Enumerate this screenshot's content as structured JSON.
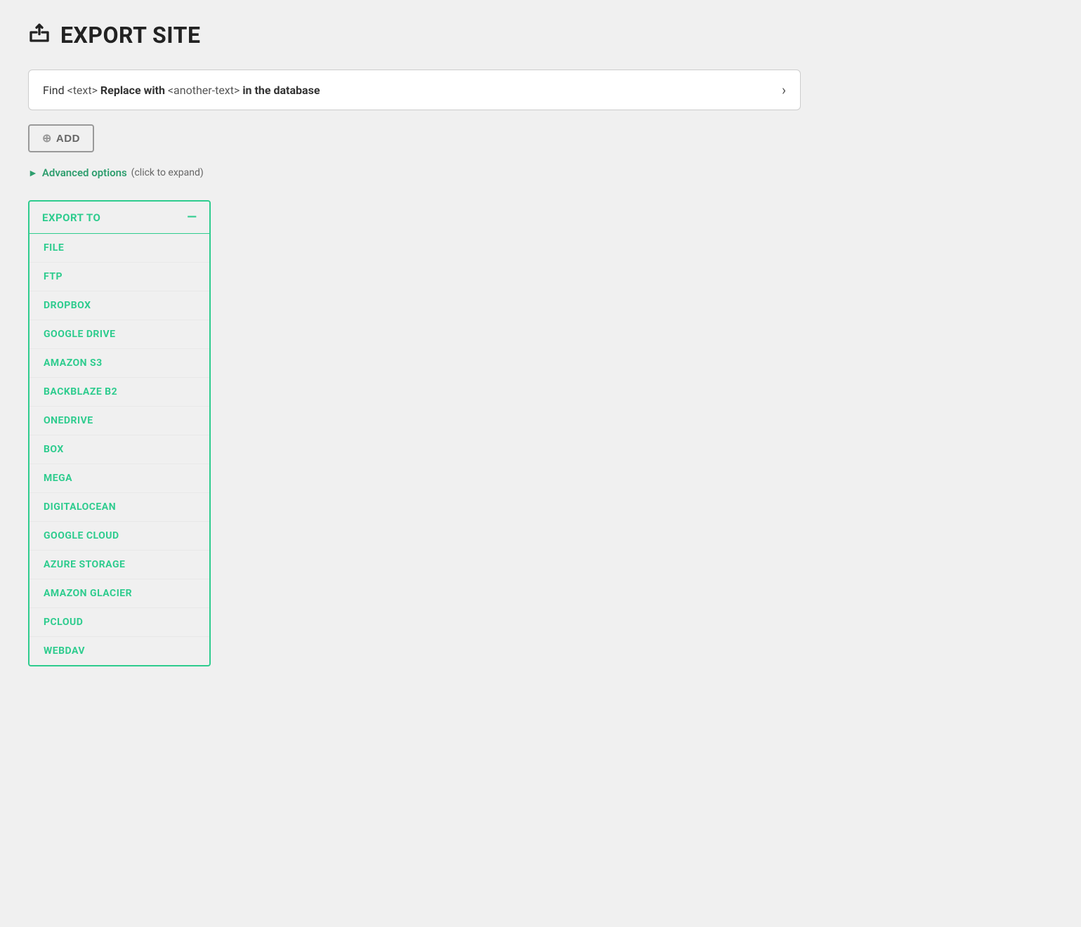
{
  "header": {
    "title": "EXPORT SITE",
    "icon": "export-icon"
  },
  "find_replace": {
    "prefix": "Find",
    "find_placeholder": "<text>",
    "action": "Replace with",
    "replace_placeholder": "<another-text>",
    "suffix": "in the database"
  },
  "add_button": {
    "label": "ADD",
    "icon": "+"
  },
  "advanced_options": {
    "label": "Advanced options",
    "hint": "(click to expand)"
  },
  "export_panel": {
    "title": "EXPORT TO",
    "collapse_icon": "—",
    "options": [
      "FILE",
      "FTP",
      "DROPBOX",
      "GOOGLE DRIVE",
      "AMAZON S3",
      "BACKBLAZE B2",
      "ONEDRIVE",
      "BOX",
      "MEGA",
      "DIGITALOCEAN",
      "GOOGLE CLOUD",
      "AZURE STORAGE",
      "AMAZON GLACIER",
      "PCLOUD",
      "WEBDAV"
    ]
  }
}
